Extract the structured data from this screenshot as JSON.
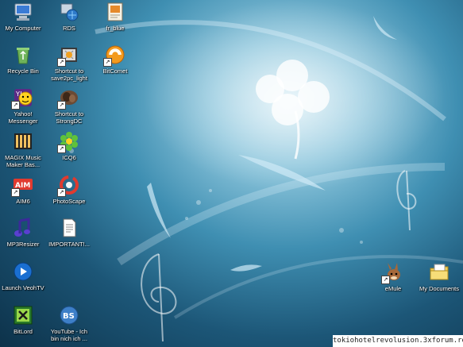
{
  "desktop": {
    "left_column_icons": [
      {
        "label": "My Computer",
        "icon": "my-computer-icon"
      },
      {
        "label": "Recycle Bin",
        "icon": "recycle-bin-icon"
      },
      {
        "label": "Yahoo!\nMessenger",
        "icon": "yahoo-messenger-icon"
      },
      {
        "label": "MAGIX Music\nMaker Bas...",
        "icon": "magix-music-maker-icon"
      },
      {
        "label": "AIM6",
        "icon": "aim-icon"
      },
      {
        "label": "MP3Resizer",
        "icon": "mp3resizer-icon"
      },
      {
        "label": "Launch VeohTV",
        "icon": "veohtv-icon"
      },
      {
        "label": "BitLord",
        "icon": "bitlord-icon"
      }
    ],
    "middle_column_icons": [
      {
        "label": "RDS",
        "icon": "rds-icon"
      },
      {
        "label": "Shortcut to\nsave2pc_light",
        "icon": "save2pc-icon"
      },
      {
        "label": "Shortcut to\nStrongDC",
        "icon": "strongdc-icon"
      },
      {
        "label": "ICQ6",
        "icon": "icq-icon"
      },
      {
        "label": "PhotoScape",
        "icon": "photoscape-icon"
      },
      {
        "label": "IMPORTANT!...",
        "icon": "text-document-icon"
      },
      {
        "label": "YouTube - Ich\nbin nich ich ...",
        "icon": "youtube-video-icon"
      }
    ],
    "right_column_icons": [
      {
        "label": "fr_blue",
        "icon": "archive-file-icon"
      },
      {
        "label": "BitComet",
        "icon": "bitcomet-icon"
      }
    ],
    "far_right_icons": [
      {
        "label": "eMule",
        "icon": "emule-icon"
      },
      {
        "label": "My Documents",
        "icon": "my-documents-icon"
      }
    ]
  },
  "watermark": "tokiohotelrevolusion.3xforum.ro"
}
